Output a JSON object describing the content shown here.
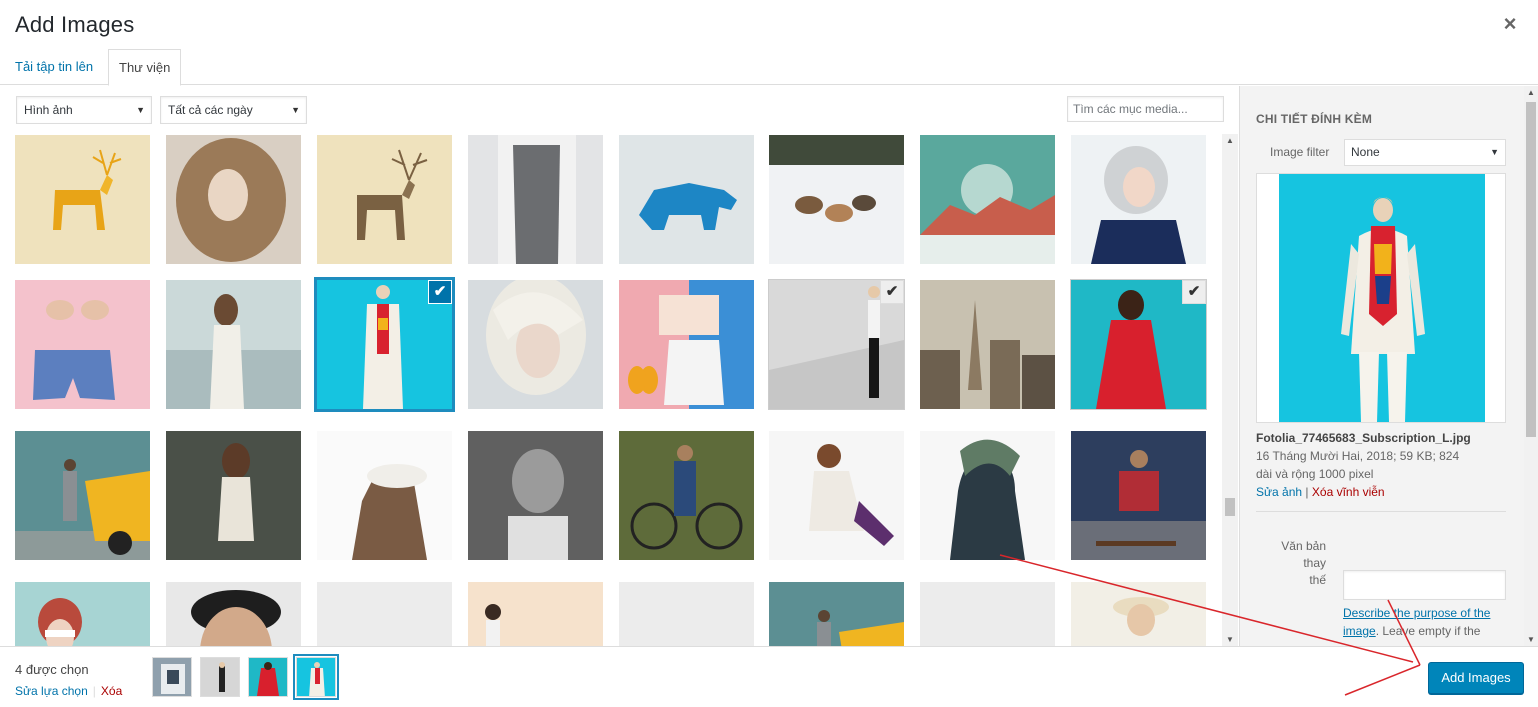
{
  "modal": {
    "title": "Add Images",
    "close_icon": "close-icon"
  },
  "tabs": [
    {
      "label": "Tải tập tin lên",
      "active": false
    },
    {
      "label": "Thư viện",
      "active": true
    }
  ],
  "toolbar": {
    "type_filter": "Hình ảnh",
    "date_filter": "Tất cả các ngày",
    "search_placeholder": "Tìm các mục media..."
  },
  "grid": {
    "items": [
      {
        "name": "deer-yellow",
        "selected": false
      },
      {
        "name": "curly-hair-woman",
        "selected": false
      },
      {
        "name": "deer-brown",
        "selected": false
      },
      {
        "name": "man-vest",
        "selected": false
      },
      {
        "name": "blue-bear",
        "selected": false
      },
      {
        "name": "sled-dogs",
        "selected": false
      },
      {
        "name": "mountain-sun",
        "selected": false
      },
      {
        "name": "silver-hair-woman",
        "selected": false
      },
      {
        "name": "swimwear-shorts",
        "selected": false
      },
      {
        "name": "woman-harbor",
        "selected": false
      },
      {
        "name": "woman-blue-bg",
        "selected": true,
        "details": true
      },
      {
        "name": "blonde-portrait",
        "selected": false
      },
      {
        "name": "summer-outfit",
        "selected": false
      },
      {
        "name": "woman-stairs",
        "selected": true
      },
      {
        "name": "city-tower",
        "selected": false
      },
      {
        "name": "red-dress",
        "selected": true
      },
      {
        "name": "woman-yellow-car",
        "selected": false
      },
      {
        "name": "woman-dark-bg",
        "selected": false
      },
      {
        "name": "double-exposure-hat",
        "selected": false
      },
      {
        "name": "woman-foliage",
        "selected": false
      },
      {
        "name": "man-bicycle",
        "selected": false
      },
      {
        "name": "woman-sitting",
        "selected": false
      },
      {
        "name": "double-exposure-man",
        "selected": false
      },
      {
        "name": "man-skateboard",
        "selected": false
      },
      {
        "name": "woman-sunglasses",
        "selected": false
      },
      {
        "name": "man-hair",
        "selected": false
      },
      {
        "name": "blank-1",
        "selected": false
      },
      {
        "name": "woman-peach",
        "selected": false
      },
      {
        "name": "blank-2",
        "selected": false
      },
      {
        "name": "yellow-car-2",
        "selected": false
      },
      {
        "name": "loading-dots",
        "selected": false
      },
      {
        "name": "woman-hat",
        "selected": false
      }
    ]
  },
  "sidebar": {
    "heading": "CHI TIẾT ĐÍNH KÈM",
    "filter_label": "Image filter",
    "filter_value": "None",
    "filename": "Fotolia_77465683_Subscription_L.jpg",
    "meta_line1": "16 Tháng Mười Hai, 2018;  59 KB;  824",
    "meta_line2": "dài và rộng 1000 pixel",
    "edit_link": "Sửa ảnh",
    "link_separator": "|",
    "delete_link": "Xóa vĩnh viễn",
    "alt_label_1": "Văn bản thay",
    "alt_label_2": "thế",
    "alt_help_link_1": "Describe the purpose of the",
    "alt_help_link_2": "image",
    "alt_help_text": ". Leave empty if the"
  },
  "footer": {
    "count_text": "4 được chọn",
    "edit_selection": "Sửa lựa chọn",
    "clear": "Xóa",
    "add_button": "Add Images"
  },
  "colors": {
    "accent": "#0073aa",
    "button": "#0085ba",
    "annotation_arrow": "#d9262b"
  }
}
